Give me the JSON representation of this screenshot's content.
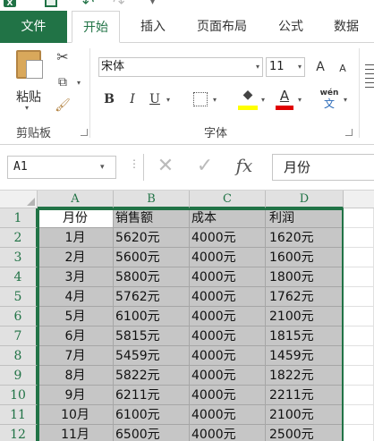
{
  "tabs": {
    "file": "文件",
    "home": "开始",
    "insert": "插入",
    "page_layout": "页面布局",
    "formulas": "公式",
    "data": "数据"
  },
  "ribbon": {
    "clipboard": {
      "paste_label": "粘贴",
      "group_label": "剪贴板"
    },
    "font": {
      "font_name": "宋体",
      "font_size": "11",
      "grow_label": "A",
      "shrink_label": "A",
      "bold_label": "B",
      "italic_label": "I",
      "underline_label": "U",
      "font_color_label": "A",
      "phonetic_label": "wén",
      "phonetic_char": "文",
      "group_label": "字体",
      "fill_color": "#ffff00",
      "font_color": "#e00000"
    }
  },
  "formula_bar": {
    "name_box": "A1",
    "fx_label": "fx",
    "formula": "月份"
  },
  "grid": {
    "columns": [
      "A",
      "B",
      "C",
      "D"
    ],
    "rows": [
      {
        "n": "1",
        "cells": [
          "月份",
          "销售额",
          "成本",
          "利润"
        ]
      },
      {
        "n": "2",
        "cells": [
          "1月",
          "5620元",
          "4000元",
          "1620元"
        ]
      },
      {
        "n": "3",
        "cells": [
          "2月",
          "5600元",
          "4000元",
          "1600元"
        ]
      },
      {
        "n": "4",
        "cells": [
          "3月",
          "5800元",
          "4000元",
          "1800元"
        ]
      },
      {
        "n": "5",
        "cells": [
          "4月",
          "5762元",
          "4000元",
          "1762元"
        ]
      },
      {
        "n": "6",
        "cells": [
          "5月",
          "6100元",
          "4000元",
          "2100元"
        ]
      },
      {
        "n": "7",
        "cells": [
          "6月",
          "5815元",
          "4000元",
          "1815元"
        ]
      },
      {
        "n": "8",
        "cells": [
          "7月",
          "5459元",
          "4000元",
          "1459元"
        ]
      },
      {
        "n": "9",
        "cells": [
          "8月",
          "5822元",
          "4000元",
          "1822元"
        ]
      },
      {
        "n": "10",
        "cells": [
          "9月",
          "6211元",
          "4000元",
          "2211元"
        ]
      },
      {
        "n": "11",
        "cells": [
          "10月",
          "6100元",
          "4000元",
          "2100元"
        ]
      },
      {
        "n": "12",
        "cells": [
          "11月",
          "6500元",
          "4000元",
          "2500元"
        ]
      }
    ]
  },
  "colors": {
    "accent": "#217346",
    "selection_fill": "#c6c6c6"
  }
}
